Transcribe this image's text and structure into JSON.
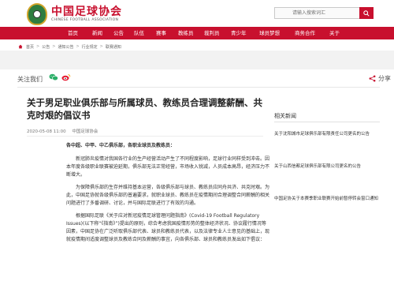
{
  "header": {
    "logo_cn": "中国足球协会",
    "logo_en": "CHINESE FOOTBALL ASSOCIATION",
    "search_placeholder": "请输入搜索词汇"
  },
  "nav": {
    "items": [
      "首页",
      "新闻",
      "公告",
      "队伍",
      "赛事",
      "教练员",
      "裁判员",
      "青少年",
      "球员梦想",
      "商务合作",
      "关于"
    ]
  },
  "breadcrumb": {
    "items": [
      "首页",
      "公告",
      "通知公告",
      "行业规定",
      "联赛通知"
    ]
  },
  "follow": {
    "label": "关注我们",
    "share_label": "分享"
  },
  "article": {
    "title": "关于男足职业俱乐部与所属球员、教练员合理调整薪酬、共克时艰的倡议书",
    "date": "2020-05-08 11:00",
    "source": "中国足球协会",
    "salutation": "各中超、中甲、中乙俱乐部，各职业球员及教练员：",
    "paragraphs": [
      "新冠肺炎疫情对我国各行业的生产经营活动产生了不同程度影响，足球行业同样受到冲击。因本年度各级职业联赛被迫延期，俱乐部无法正常经营，市场收入锐减，人员成本高昂，经济压力不断增大。",
      "为保障俱乐部的生存并维持基本运营，各级俱乐部与球员、教练员应同舟共济、共克时艰。为此，中国足协就各级俱乐部的普遍要求，就职业球员、教练员在疫情期间合理调整合同薪酬的相关问题进行了多番调研、讨论，并与国际足联进行了有效的沟通。",
      "根据国际足联《关于应对新冠疫情足球管理问题指南》(Covid-19 Football Regulatory Issues)(以下称“《指南》”)提出的原则，综合考虑我国疫情形势的整体经济状况、协议履行情况等因素，中国足协在广泛听取俱乐部代表、球员和教练员代表，以及法律专业人士意见的基础上，现就疫情期间适度调整球员及教练合同及薪酬的事宜，向各俱乐部、球员和教练员发出如下倡议："
    ]
  },
  "sidebar": {
    "title": "相关新闻",
    "items": [
      "关于沈阳城市足球俱乐部有限责任公司更名的公告",
      "关于山西信都足球俱乐部有限公司更名的公告",
      "中国足协关于本赛季职业联赛开始前暂停转会窗口通知"
    ]
  },
  "colors": {
    "brand_red": "#c8102e",
    "brand_green": "#2f7d3f"
  }
}
